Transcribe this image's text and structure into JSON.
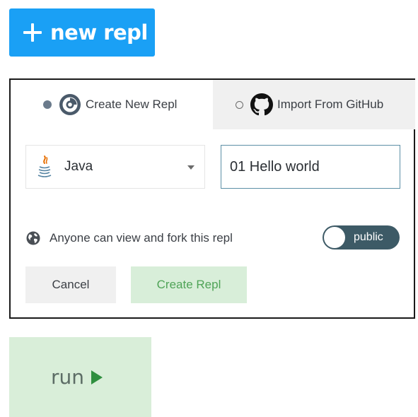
{
  "new_repl_button": {
    "label": "new repl",
    "icon": "plus-icon",
    "color": "#1aa0f5"
  },
  "dialog": {
    "tabs": [
      {
        "label": "Create New Repl",
        "icon": "repl-spiral-icon",
        "selected": true
      },
      {
        "label": "Import From GitHub",
        "icon": "github-icon",
        "selected": false
      }
    ],
    "language": {
      "selected": "Java",
      "icon": "java-icon"
    },
    "repl_name": {
      "value": "01 Hello world"
    },
    "visibility": {
      "text": "Anyone can view and fork this repl",
      "icon": "globe-icon",
      "toggle_label": "public"
    },
    "buttons": {
      "cancel": "Cancel",
      "create": "Create Repl"
    }
  },
  "run_button": {
    "label": "run",
    "icon": "play-icon",
    "color": "#2f8f3f"
  }
}
